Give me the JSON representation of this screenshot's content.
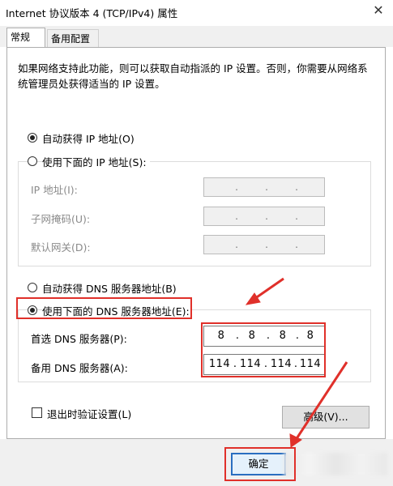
{
  "window": {
    "title": "Internet 协议版本 4 (TCP/IPv4) 属性",
    "close_glyph": "✕"
  },
  "tabs": [
    {
      "label": "常规",
      "active": true
    },
    {
      "label": "备用配置",
      "active": false
    }
  ],
  "description": "如果网络支持此功能，则可以获取自动指派的 IP 设置。否则，你需要从网络系统管理员处获得适当的 IP 设置。",
  "ip_section": {
    "auto_label": "自动获得 IP 地址(O)",
    "auto_checked": true,
    "manual_label": "使用下面的 IP 地址(S):",
    "manual_checked": false,
    "fields": [
      {
        "label": "IP 地址(I):"
      },
      {
        "label": "子网掩码(U):"
      },
      {
        "label": "默认网关(D):"
      }
    ]
  },
  "dns_section": {
    "auto_label": "自动获得 DNS 服务器地址(B)",
    "auto_checked": false,
    "manual_label": "使用下面的 DNS 服务器地址(E):",
    "manual_checked": true,
    "preferred": {
      "label": "首选 DNS 服务器(P):",
      "octets": [
        "8",
        "8",
        "8",
        "8"
      ]
    },
    "alternate": {
      "label": "备用 DNS 服务器(A):",
      "octets": [
        "114",
        "114",
        "114",
        "114"
      ]
    }
  },
  "validate_label": "退出时验证设置(L)",
  "validate_checked": false,
  "buttons": {
    "advanced": "高级(V)...",
    "ok": "确定"
  },
  "colors": {
    "annotation_red": "#e0302a",
    "primary_border": "#2a6ec0"
  }
}
